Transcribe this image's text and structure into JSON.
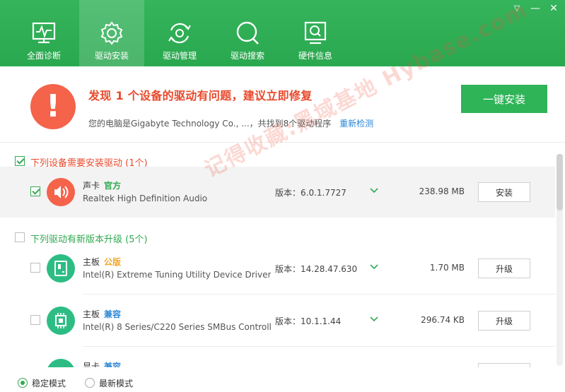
{
  "window": {
    "menu_glyph": "▽",
    "minimize_glyph": "—",
    "close_glyph": "✕"
  },
  "tabs": [
    {
      "label": "全面诊断",
      "icon": "monitor-pulse-icon",
      "active": false
    },
    {
      "label": "驱动安装",
      "icon": "gear-icon",
      "active": true
    },
    {
      "label": "驱动管理",
      "icon": "gear-refresh-icon",
      "active": false
    },
    {
      "label": "驱动搜索",
      "icon": "search-icon",
      "active": false
    },
    {
      "label": "硬件信息",
      "icon": "hardware-search-icon",
      "active": false
    }
  ],
  "alert": {
    "icon_glyph": "!",
    "title": "发现 1 个设备的驱动有问题，建议立即修复",
    "subtitle": "您的电脑是Gigabyte Technology Co., ...，共找到8个驱动程序",
    "redetect_label": "重新检测",
    "install_all_label": "一键安装"
  },
  "sections": [
    {
      "title": "下列设备需要安装驱动 (1个)",
      "checked": true,
      "color": "#e9492c"
    },
    {
      "title": "下列驱动有新版本升级 (5个)",
      "checked": false,
      "color": "#2fa94f"
    }
  ],
  "drivers": [
    {
      "type": "声卡",
      "tag": "官方",
      "tag_color": "#2fa94f",
      "icon": "speaker-icon",
      "icon_color": "#f4634a",
      "name": "Realtek High Definition Audio",
      "version_label": "版本：",
      "version": "6.0.1.7727",
      "size": "238.98 MB",
      "action": "安装",
      "checked": true
    },
    {
      "type": "主板",
      "tag": "公版",
      "tag_color": "#f5a623",
      "icon": "motherboard-icon",
      "icon_color": "#2dbd84",
      "name": "Intel(R) Extreme Tuning Utility Device Driver",
      "version_label": "版本：",
      "version": "14.28.47.630",
      "size": "1.70 MB",
      "action": "升级",
      "checked": false
    },
    {
      "type": "主板",
      "tag": "兼容",
      "tag_color": "#2a86d6",
      "icon": "chip-icon",
      "icon_color": "#2dbd84",
      "name": "Intel(R) 8 Series/C220 Series SMBus Controlle",
      "version_label": "版本：",
      "version": "10.1.1.44",
      "size": "296.74 KB",
      "action": "升级",
      "checked": false
    },
    {
      "type": "显卡",
      "tag": "兼容",
      "tag_color": "#2a86d6",
      "icon": "gpu-icon",
      "icon_color": "#2dbd84",
      "name": "",
      "version_label": "",
      "version": "",
      "size": "",
      "action": "",
      "checked": false
    }
  ],
  "footer": {
    "mode_stable": "稳定模式",
    "mode_latest": "最新模式",
    "selected": "stable"
  },
  "watermark": "记得收藏:黑域基地 Hybase.com",
  "colors": {
    "brand": "#2fb458",
    "danger": "#f4634a",
    "link": "#2a86d6"
  }
}
